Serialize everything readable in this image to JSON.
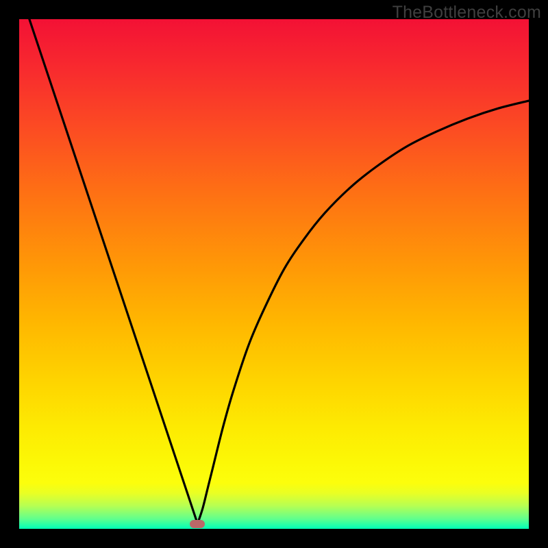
{
  "watermark": "TheBottleneck.com",
  "colors": {
    "frame": "#000000",
    "curve_stroke": "#000000",
    "marker": "#bb6868"
  },
  "chart_data": {
    "type": "line",
    "title": "",
    "xlabel": "",
    "ylabel": "",
    "xlim": [
      0,
      100
    ],
    "ylim": [
      0,
      100
    ],
    "grid": false,
    "series": [
      {
        "name": "left-branch",
        "x": [
          2,
          6,
          10,
          14,
          18,
          22,
          26,
          29,
          31,
          33,
          34,
          35
        ],
        "values": [
          100,
          88,
          76,
          64,
          52,
          40,
          28,
          19,
          13,
          7,
          4,
          1
        ]
      },
      {
        "name": "right-branch",
        "x": [
          35,
          36,
          37,
          38,
          40,
          42,
          45,
          48,
          52,
          56,
          60,
          65,
          70,
          76,
          82,
          88,
          94,
          100
        ],
        "values": [
          1,
          4,
          8,
          12,
          20,
          27,
          36,
          43,
          51,
          57,
          62,
          67,
          71,
          75,
          78,
          80.5,
          82.5,
          84
        ]
      }
    ],
    "annotations": [
      {
        "name": "minimum-marker",
        "x": 35,
        "y": 1
      }
    ]
  }
}
